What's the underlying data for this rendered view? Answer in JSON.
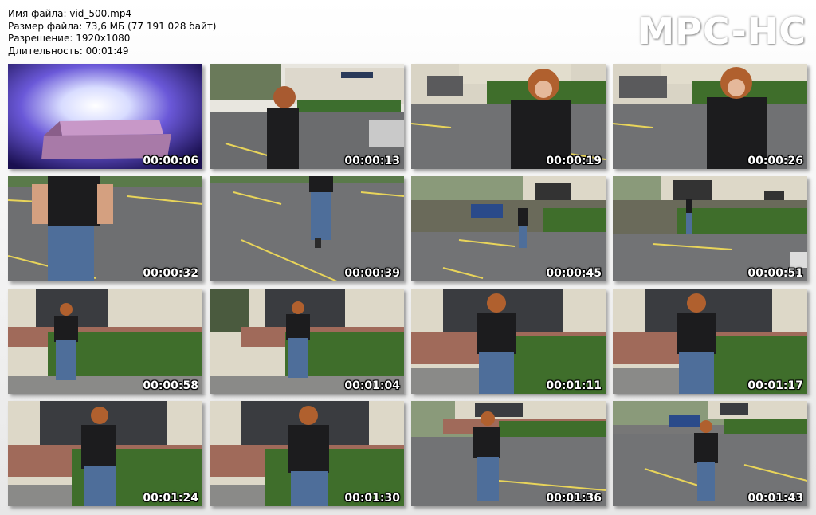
{
  "info": {
    "filename": "Имя файла: vid_500.mp4",
    "filesize": "Размер файла: 73,6 МБ (77 191 028 байт)",
    "resolution": "Разрешение: 1920x1080",
    "duration": "Длительность: 00:01:49"
  },
  "logo": "MPC-HC",
  "thumbnails": [
    {
      "time": "00:00:06"
    },
    {
      "time": "00:00:13"
    },
    {
      "time": "00:00:19"
    },
    {
      "time": "00:00:26"
    },
    {
      "time": "00:00:32"
    },
    {
      "time": "00:00:39"
    },
    {
      "time": "00:00:45"
    },
    {
      "time": "00:00:51"
    },
    {
      "time": "00:00:58"
    },
    {
      "time": "00:01:04"
    },
    {
      "time": "00:01:11"
    },
    {
      "time": "00:01:17"
    },
    {
      "time": "00:01:24"
    },
    {
      "time": "00:01:30"
    },
    {
      "time": "00:01:36"
    },
    {
      "time": "00:01:43"
    }
  ]
}
